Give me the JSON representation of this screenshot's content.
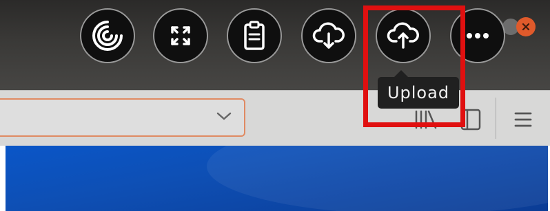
{
  "toolbar": {
    "buttons": [
      {
        "name": "spinner-button",
        "icon": "loading-spinner-icon"
      },
      {
        "name": "fullscreen-button",
        "icon": "expand-icon"
      },
      {
        "name": "clipboard-button",
        "icon": "clipboard-icon"
      },
      {
        "name": "download-button",
        "icon": "cloud-download-icon"
      },
      {
        "name": "upload-button",
        "icon": "cloud-upload-icon"
      },
      {
        "name": "more-button",
        "icon": "ellipsis-icon"
      }
    ]
  },
  "tooltip": {
    "label": "Upload"
  },
  "window_controls": {
    "close_color": "#e05a2b",
    "minimize_color": "#6f6f6f"
  },
  "browser": {
    "url_dropdown_icon": "chevron-down-icon",
    "library_icon": "library-icon",
    "sidebar_icon": "sidebar-icon",
    "menu_icon": "hamburger-menu-icon"
  },
  "colors": {
    "highlight": "#e01010",
    "urlbar_border": "#e08a62",
    "desktop": "#0e4fb4"
  }
}
